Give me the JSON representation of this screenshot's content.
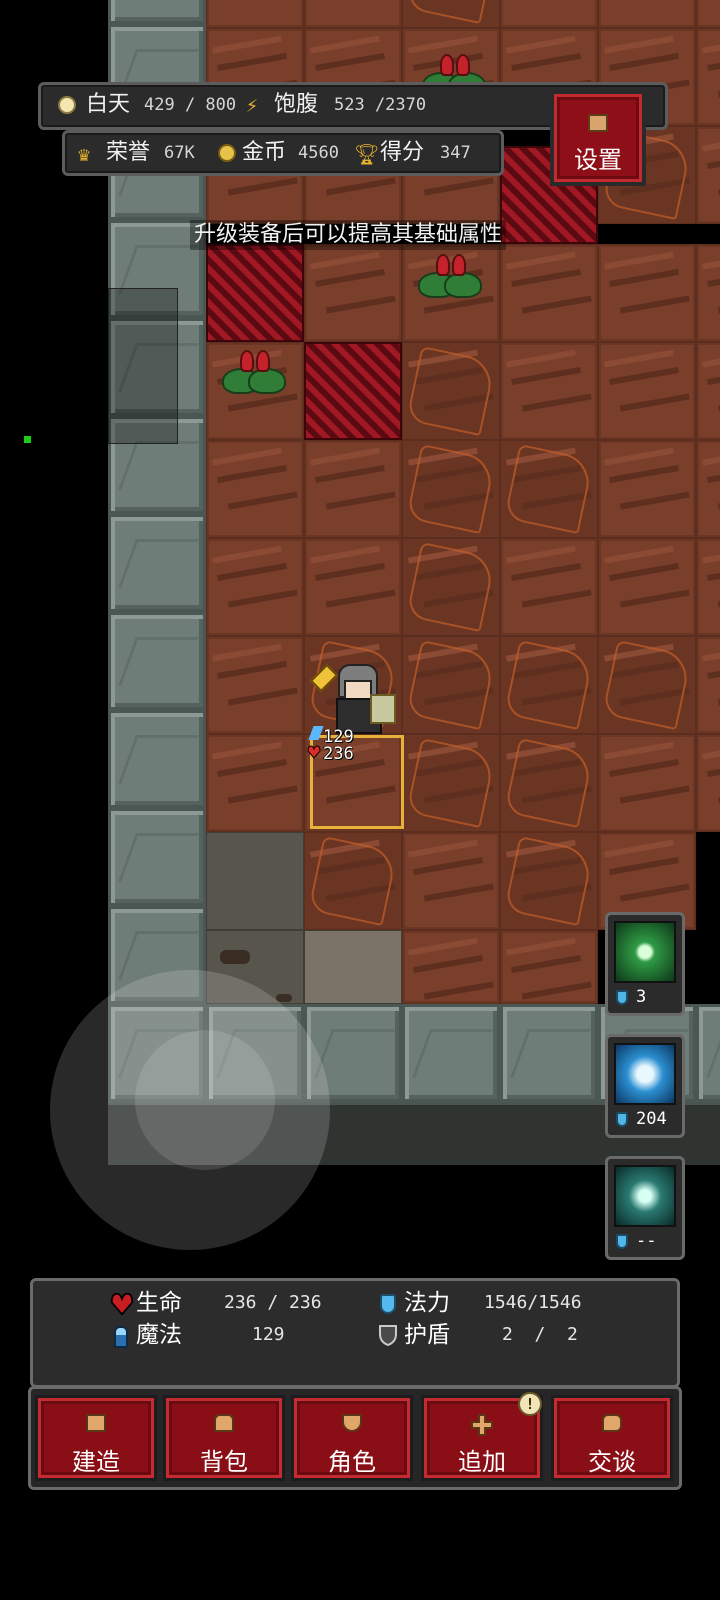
{
  "hud": {
    "day_label": "白天",
    "day_value": "429 / 800",
    "hunger_label": "饱腹",
    "hunger_value": "523 /2370",
    "honor_label": "荣誉",
    "honor_value": "67K",
    "gold_label": "金币",
    "gold_value": "4560",
    "score_label": "得分",
    "score_value": "347",
    "settings_label": "设置"
  },
  "tip": "升级装备后可以提高其基础属性",
  "hero": {
    "mana_value": "129",
    "hp_value": "236"
  },
  "skills": [
    {
      "name": "holy-cross-skill",
      "cost": "3",
      "color": "#1e8a3a"
    },
    {
      "name": "ice-shield-skill",
      "cost": "204",
      "color": "#2b8fd1"
    },
    {
      "name": "shield-skill",
      "cost": "--",
      "color": "#1f6b66"
    }
  ],
  "stats": {
    "hp_label": "生命",
    "hp_value": "236 / 236",
    "mp_label": "法力",
    "mp_value": "1546/1546",
    "magic_label": "魔法",
    "magic_value": "129",
    "shield_label": "护盾",
    "shield_value": "2  /  2"
  },
  "nav": {
    "build": "建造",
    "bag": "背包",
    "character": "角色",
    "add": "追加",
    "talk": "交谈",
    "add_badge": "!"
  },
  "colors": {
    "accent_red": "#8e0f18",
    "tile_highlight": "#e6b23a",
    "indicator_green": "#19d019"
  }
}
